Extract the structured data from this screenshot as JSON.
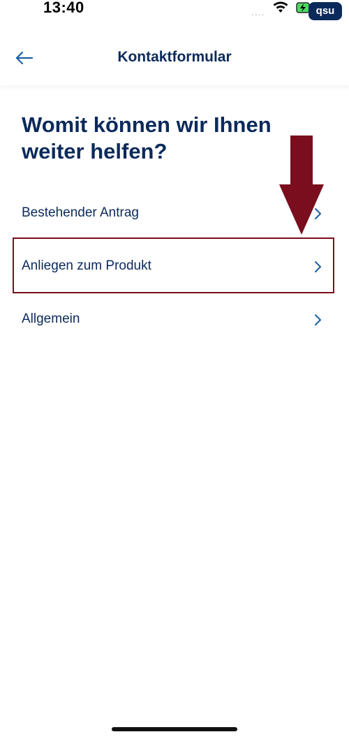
{
  "status_bar": {
    "time": "13:40",
    "signal": "....",
    "user_badge": "qsu"
  },
  "header": {
    "title": "Kontaktformular",
    "back_icon": "arrow-left-icon"
  },
  "main": {
    "headline": "Womit können wir Ihnen weiter helfen?",
    "options": [
      {
        "label": "Bestehender Antrag",
        "icon": "chevron-right-icon"
      },
      {
        "label": "Anliegen zum Produkt",
        "icon": "chevron-right-icon"
      },
      {
        "label": "Allgemein",
        "icon": "chevron-right-icon"
      }
    ]
  },
  "annotation": {
    "highlighted_option": "Anliegen zum Produkt",
    "color": "#7a0e1e"
  },
  "colors": {
    "primary": "#0b2a5b",
    "accent": "#1a5fa8"
  }
}
